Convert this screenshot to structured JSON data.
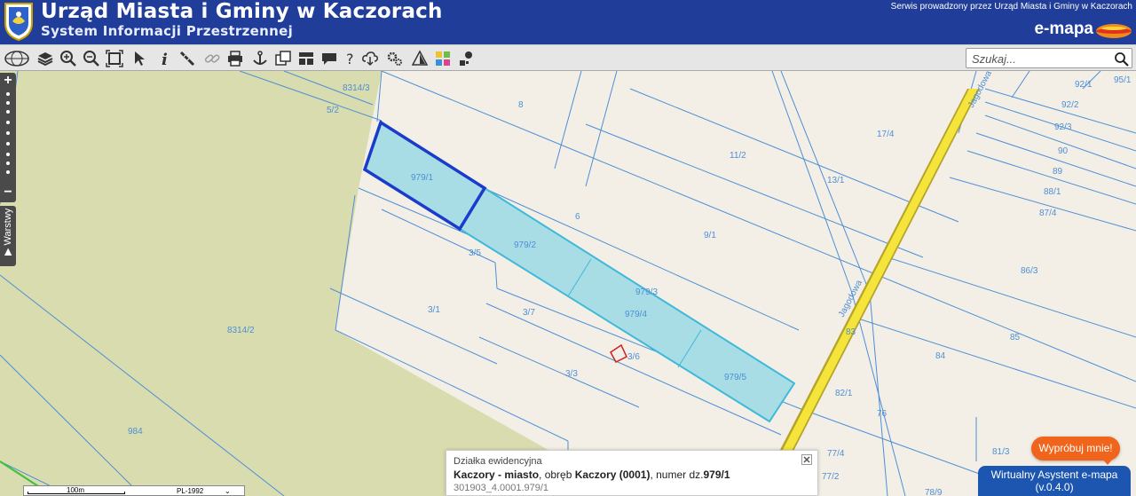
{
  "header": {
    "title": "Urząd Miasta i Gminy w Kaczorach",
    "subtitle": "System Informacji Przestrzennej",
    "service_note": "Serwis prowadzony przez Urząd Miasta i Gminy w Kaczorach",
    "brand": "e-mapa"
  },
  "toolbar": {
    "tools": [
      "globe-icon",
      "layers-icon",
      "zoom-in-icon",
      "zoom-out-icon",
      "zoom-extent-icon",
      "select-icon",
      "info-icon",
      "measure-icon",
      "link-icon",
      "print-icon",
      "anchor-icon",
      "copy-icon",
      "layout-icon",
      "comment-icon",
      "help-icon",
      "download-icon",
      "settings-icon",
      "warning-icon",
      "legend-icon",
      "marker-icon"
    ],
    "search_placeholder": "Szukaj..."
  },
  "map": {
    "labels": {
      "p8314_3": "8314/3",
      "p5_2": "5/2",
      "p8": "8",
      "p979_1": "979/1",
      "p11_2": "11/2",
      "p6": "6",
      "p979_2": "979/2",
      "p9_1": "9/1",
      "p979_3": "979/3",
      "p979_4": "979/4",
      "p3_5": "3/5",
      "p3_1": "3/1",
      "p3_7": "3/7",
      "p8314_2": "8314/2",
      "p3_6": "3/6",
      "p3_3": "3/3",
      "p979_5": "979/5",
      "p984": "984",
      "p17_4": "17/4",
      "p13_1": "13/1",
      "p92_1": "92/1",
      "p95_1": "95/1",
      "p92_2": "92/2",
      "p92_3": "92/3",
      "p90": "90",
      "p89": "89",
      "p88_1": "88/1",
      "p87_4": "87/4",
      "p86_3": "86/3",
      "p85": "85",
      "p84": "84",
      "p83": "83",
      "p82_1": "82/1",
      "p76": "76",
      "p77_4": "77/4",
      "p81_3": "81/3",
      "p78_9": "78/9",
      "p77_2": "77/2",
      "street_top": "Jagodowa",
      "street_mid": "Jagodowa"
    }
  },
  "zoombar": {
    "plus": "+",
    "minus": "−"
  },
  "layers_tab": {
    "label": "▶ Warstwy"
  },
  "popup": {
    "type": "Działka ewidencyjna",
    "place": "Kaczory - miasto",
    "text1": ", obręb ",
    "precinct": "Kaczory (0001)",
    "text2": ", numer dz.",
    "parcel": "979/1",
    "id": "301903_4.0001.979/1"
  },
  "scalebar": {
    "distance": "100m",
    "crs": "PL-1992",
    "arrow": "⌄"
  },
  "assistant": {
    "try_label": "Wypróbuj mnie!",
    "name": "Wirtualny Asystent e-mapa",
    "version": "(v.0.4.0)"
  },
  "colors": {
    "header": "#1f3d99",
    "parcel_line": "#4d8fd6",
    "selected": "#1a3ccc",
    "highlight_fill": "#a8dde6",
    "highlight_stroke": "#3fb9d9",
    "road": "#f5e43a",
    "field": "#d9dcae"
  }
}
